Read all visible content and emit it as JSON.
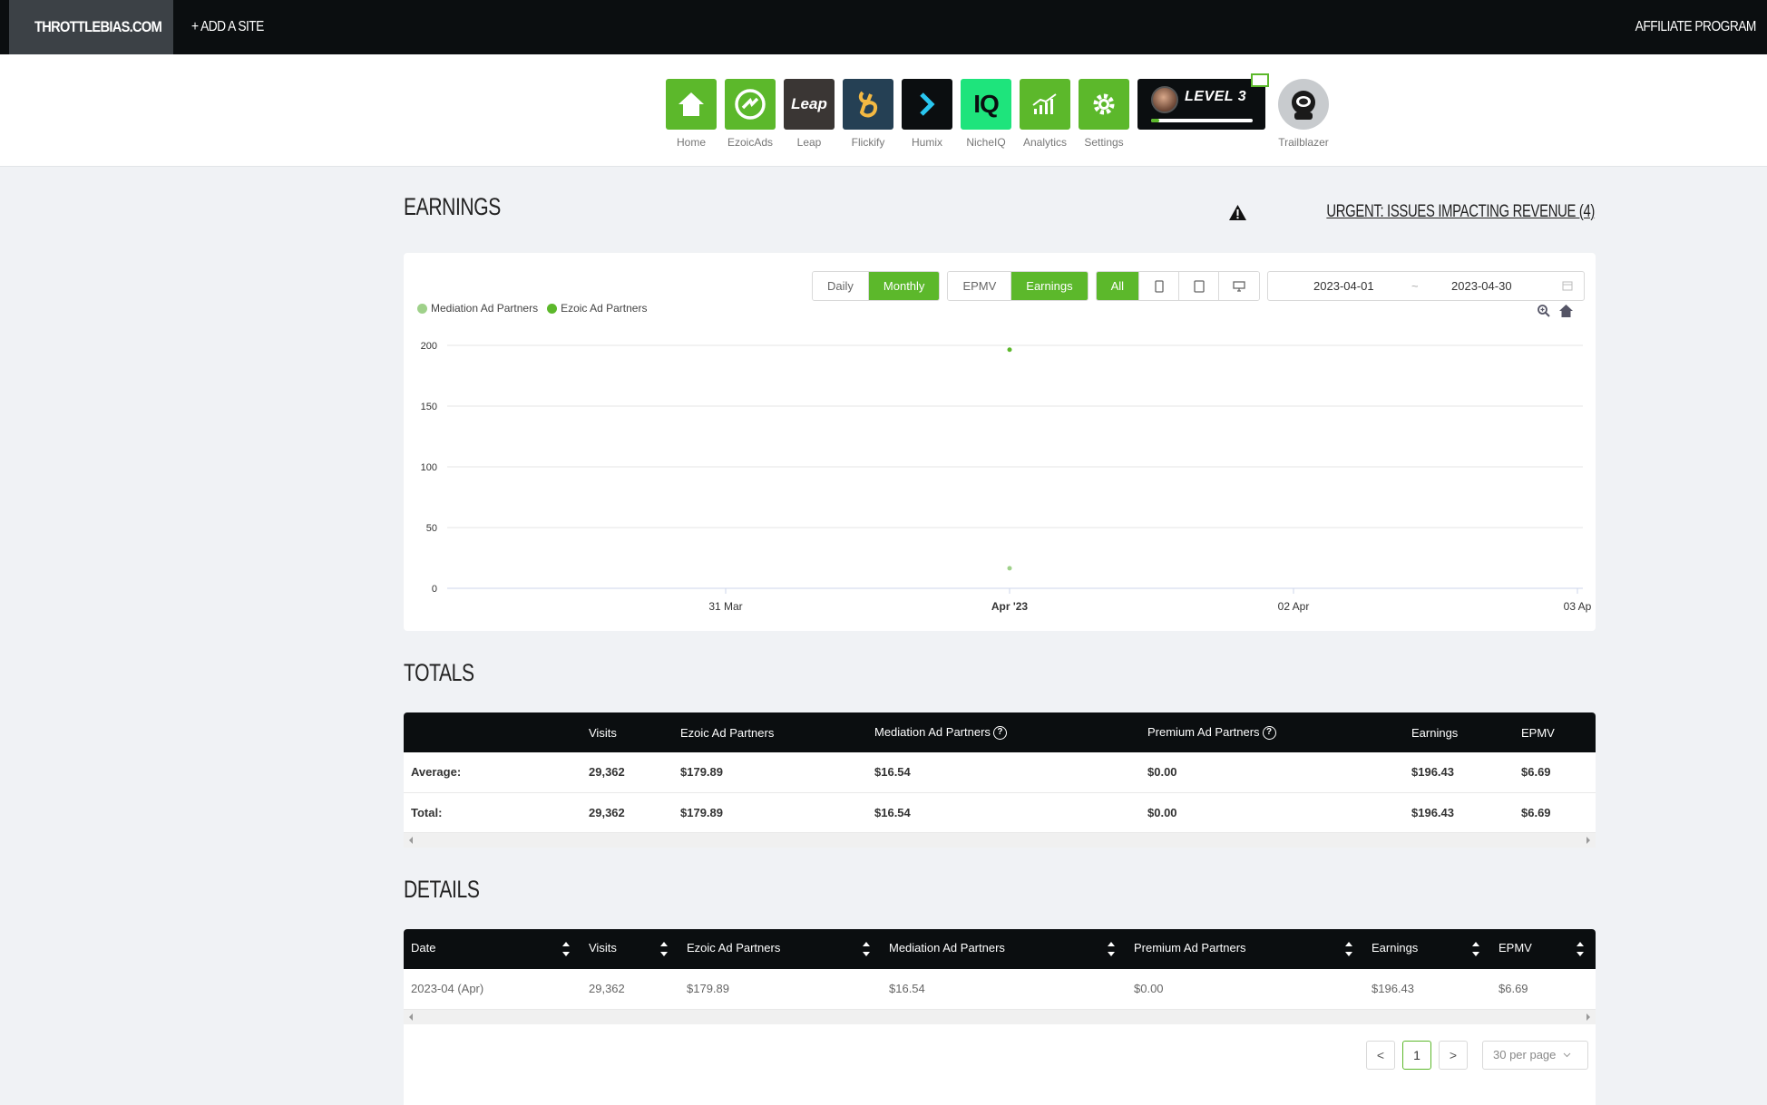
{
  "topbar": {
    "site_name": "THROTTLEBIAS.COM",
    "add_site": "+ ADD A SITE",
    "affiliate": "AFFILIATE PROGRAM"
  },
  "apps": [
    {
      "label": "Home",
      "color": "#5cb82b",
      "icon": "home-icon"
    },
    {
      "label": "EzoicAds",
      "color": "#5cb82b",
      "icon": "ezoicads-icon"
    },
    {
      "label": "Leap",
      "color": "#3a3634",
      "icon": "leap-icon"
    },
    {
      "label": "Flickify",
      "color": "#254054",
      "icon": "flickify-icon"
    },
    {
      "label": "Humix",
      "color": "#0b0e10",
      "icon": "humix-icon"
    },
    {
      "label": "NicheIQ",
      "color": "#1ee47c",
      "icon": "nicheiq-icon"
    },
    {
      "label": "Analytics",
      "color": "#5cb82b",
      "icon": "analytics-icon"
    },
    {
      "label": "Settings",
      "color": "#5cb82b",
      "icon": "gear-icon"
    }
  ],
  "apps_text": {
    "leap_logo": "Leap",
    "nicheiq_logo": "IQ"
  },
  "level": {
    "text": "LEVEL 3",
    "progress": 0.08
  },
  "trailblazer": {
    "label": "Trailblazer"
  },
  "earnings": {
    "title": "EARNINGS",
    "urgent": "URGENT: ISSUES IMPACTING REVENUE (4)"
  },
  "controls": {
    "period": [
      "Daily",
      "Monthly"
    ],
    "period_selected": "Monthly",
    "metric": [
      "EPMV",
      "Earnings"
    ],
    "metric_selected": "Earnings",
    "device": "All",
    "start_date": "2023-04-01",
    "end_date": "2023-04-30",
    "date_sep": "~"
  },
  "chart_data": {
    "type": "scatter",
    "title": "",
    "xlabel": "",
    "ylabel": "",
    "x_ticks": [
      "31 Mar",
      "Apr '23",
      "02 Apr",
      "03 Ap"
    ],
    "y_ticks": [
      0,
      50,
      100,
      150,
      200
    ],
    "ylim": [
      0,
      200
    ],
    "legend_position": "top-left",
    "series": [
      {
        "name": "Mediation Ad Partners",
        "color": "#9fd18a",
        "points": [
          {
            "x": "Apr '23",
            "y": 16.54
          }
        ]
      },
      {
        "name": "Ezoic Ad Partners",
        "color": "#5cb82b",
        "points": [
          {
            "x": "Apr '23",
            "y": 196.43
          }
        ]
      }
    ]
  },
  "totals": {
    "title": "TOTALS",
    "headers": [
      "",
      "Visits",
      "Ezoic Ad Partners",
      "Mediation Ad Partners",
      "Premium Ad Partners",
      "Earnings",
      "EPMV"
    ],
    "rows": [
      [
        "Average:",
        "29,362",
        "$179.89",
        "$16.54",
        "$0.00",
        "$196.43",
        "$6.69"
      ],
      [
        "Total:",
        "29,362",
        "$179.89",
        "$16.54",
        "$0.00",
        "$196.43",
        "$6.69"
      ]
    ]
  },
  "details": {
    "title": "DETAILS",
    "headers": [
      "Date",
      "Visits",
      "Ezoic Ad Partners",
      "Mediation Ad Partners",
      "Premium Ad Partners",
      "Earnings",
      "EPMV"
    ],
    "rows": [
      [
        "2023-04 (Apr)",
        "29,362",
        "$179.89",
        "$16.54",
        "$0.00",
        "$196.43",
        "$6.69"
      ]
    ]
  },
  "pagination": {
    "prev": "<",
    "current": "1",
    "next": ">",
    "per_page": "30 per page"
  }
}
